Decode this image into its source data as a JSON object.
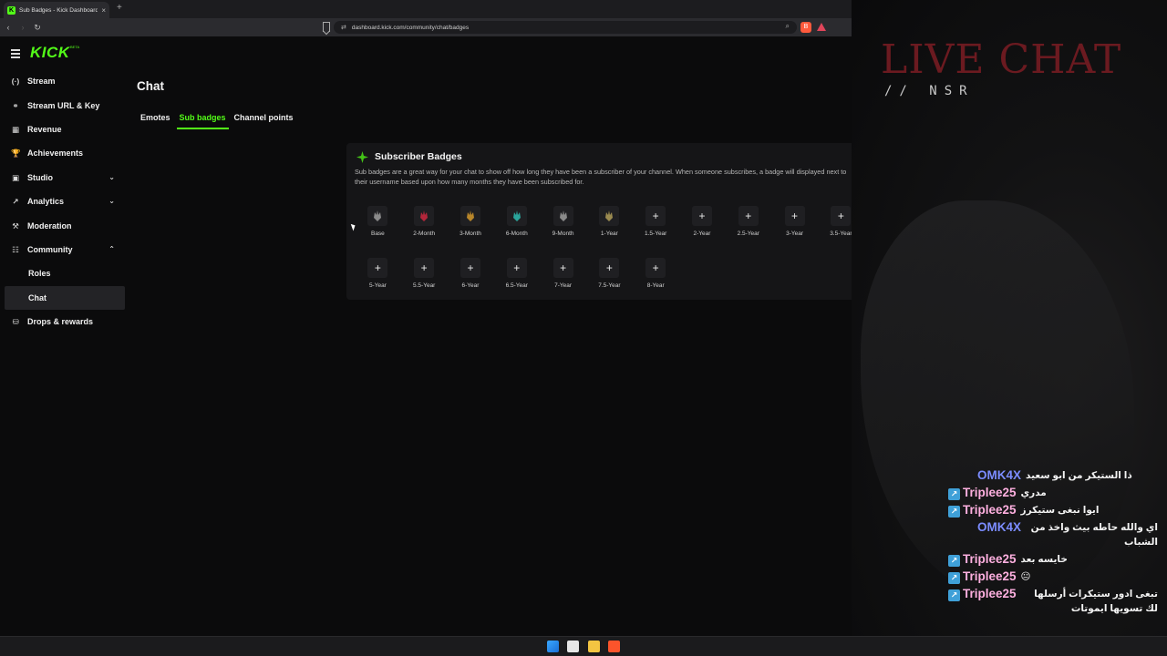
{
  "browser": {
    "tab_title": "Sub Badges - Kick Dashboard",
    "favicon_letter": "K",
    "tab_close": "×",
    "newtab": "+",
    "url": "dashboard.kick.com/community/chat/badges",
    "back": "‹",
    "forward": "›",
    "reload": "↻",
    "lock": "⇄",
    "zoom_icon": "⌕",
    "ext_letter": "B"
  },
  "app": {
    "logo": "KICK",
    "logo_badge": "BETA"
  },
  "sidebar": {
    "items": [
      {
        "label": "Stream",
        "icon": "(·)"
      },
      {
        "label": "Stream URL & Key",
        "icon": "⚭"
      },
      {
        "label": "Revenue",
        "icon": "▦"
      },
      {
        "label": "Achievements",
        "icon": "🏆"
      },
      {
        "label": "Studio",
        "icon": "▣",
        "chevron": "⌄"
      },
      {
        "label": "Analytics",
        "icon": "↗",
        "chevron": "⌄"
      },
      {
        "label": "Moderation",
        "icon": "⚒"
      },
      {
        "label": "Community",
        "icon": "☷",
        "chevron": "⌃"
      }
    ],
    "subitems": [
      {
        "label": "Roles"
      },
      {
        "label": "Chat"
      }
    ],
    "last_item": {
      "label": "Drops & rewards",
      "icon": "⛁"
    }
  },
  "main": {
    "title": "Chat",
    "tabs": [
      {
        "label": "Emotes"
      },
      {
        "label": "Sub badges"
      },
      {
        "label": "Channel points"
      }
    ],
    "card": {
      "title": "Subscriber Badges",
      "description": "Sub badges are a great way for your chat to show off how long they have been a subscriber of your channel. When someone subscribes, a badge will displayed next to their username based upon how many months they have been subscribed for.",
      "row1": [
        {
          "label": "Base",
          "color": "#8a8a8a"
        },
        {
          "label": "2-Month",
          "color": "#b3263a"
        },
        {
          "label": "3-Month",
          "color": "#b8862a"
        },
        {
          "label": "6-Month",
          "color": "#2aa39a"
        },
        {
          "label": "9-Month",
          "color": "#8a8a8a"
        },
        {
          "label": "1-Year",
          "color": "#9a8a50"
        },
        {
          "label": "1.5-Year",
          "symbol": "+"
        },
        {
          "label": "2-Year",
          "symbol": "+"
        },
        {
          "label": "2.5-Year",
          "symbol": "+"
        },
        {
          "label": "3-Year",
          "symbol": "+"
        },
        {
          "label": "3.5-Year",
          "symbol": "+"
        }
      ],
      "row2": [
        {
          "label": "5-Year",
          "symbol": "+"
        },
        {
          "label": "5.5-Year",
          "symbol": "+"
        },
        {
          "label": "6-Year",
          "symbol": "+"
        },
        {
          "label": "6.5-Year",
          "symbol": "+"
        },
        {
          "label": "7-Year",
          "symbol": "+"
        },
        {
          "label": "7.5-Year",
          "symbol": "+"
        },
        {
          "label": "8-Year",
          "symbol": "+"
        }
      ]
    }
  },
  "overlay": {
    "title": "LIVE CHAT",
    "subtitle": "// NSR",
    "messages": [
      {
        "user": "OMK4X",
        "text": "ذا الستيكر من ابو سعيد",
        "badge": false
      },
      {
        "user": "Triplee25",
        "text": "مدري",
        "badge": true
      },
      {
        "user": "Triplee25",
        "text": "ايوا نبغى ستيكرز",
        "badge": true
      },
      {
        "user": "OMK4X",
        "text": "اي والله حاطه بيث واخذ من الشباب",
        "badge": false
      },
      {
        "user": "Triplee25",
        "text": "خايسه بعد",
        "badge": true
      },
      {
        "user": "Triplee25",
        "text": "😐",
        "badge": true
      },
      {
        "user": "Triplee25",
        "text": "تبغى ادور ستيكرات أرسلها لك تسويها ايموتات",
        "badge": true
      }
    ]
  },
  "colors": {
    "accent": "#53fc18",
    "overlay_title": "#6b1a20"
  }
}
